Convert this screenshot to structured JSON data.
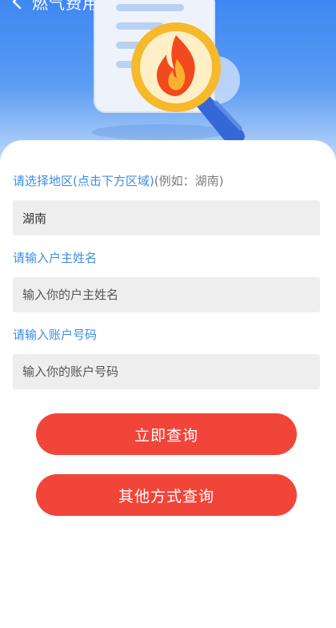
{
  "header": {
    "title": "燃气费用查询",
    "back_icon": "chevron-left-icon",
    "illustration_icon": "magnifier-flame-icon"
  },
  "form": {
    "region": {
      "label_primary": "请选择地区(点击下方区域)",
      "label_hint": "(例如：湖南)",
      "value": "湖南"
    },
    "owner_name": {
      "label": "请输入户主姓名",
      "placeholder": "输入你的户主姓名"
    },
    "account_number": {
      "label": "请输入账户号码",
      "placeholder": "输入你的账户号码"
    }
  },
  "buttons": {
    "query_now": "立即查询",
    "other_methods": "其他方式查询"
  },
  "colors": {
    "accent_blue": "#3a8ee6",
    "button_red": "#f2453a",
    "field_bg": "#eeeeee"
  }
}
